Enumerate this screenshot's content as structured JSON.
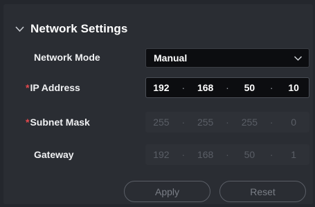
{
  "section": {
    "title": "Network Settings",
    "icon": "chevron-down-icon"
  },
  "fields": {
    "network_mode": {
      "label": "Network Mode",
      "value": "Manual",
      "icon": "chevron-down-icon"
    },
    "ip_address": {
      "label": "IP Address",
      "required_mark": "*",
      "octets": [
        "192",
        "168",
        "50",
        "10"
      ],
      "separator": "·"
    },
    "subnet_mask": {
      "label": "Subnet Mask",
      "required_mark": "*",
      "octets": [
        "255",
        "255",
        "255",
        "0"
      ],
      "separator": "·"
    },
    "gateway": {
      "label": "Gateway",
      "octets": [
        "192",
        "168",
        "50",
        "1"
      ],
      "separator": "·"
    }
  },
  "actions": {
    "apply_label": "Apply",
    "reset_label": "Reset"
  },
  "colors": {
    "background": "#2a2d33",
    "required": "#e5484d",
    "active_input": "#0c0d10",
    "disabled_input": "#2e3137"
  }
}
